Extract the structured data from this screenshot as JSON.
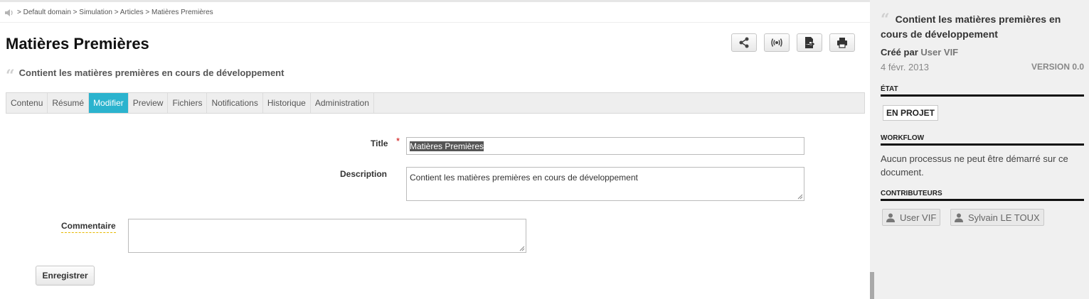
{
  "breadcrumb": "> Default domain > Simulation > Articles > Matières Premières",
  "page": {
    "title": "Matières Premières",
    "subtitle": "Contient les matières premières en cours de développement"
  },
  "actions": [
    {
      "icon": "share-icon"
    },
    {
      "icon": "broadcast-icon"
    },
    {
      "icon": "export-icon"
    },
    {
      "icon": "print-icon"
    }
  ],
  "tabs": [
    {
      "label": "Contenu"
    },
    {
      "label": "Résumé"
    },
    {
      "label": "Modifier",
      "active": true
    },
    {
      "label": "Preview"
    },
    {
      "label": "Fichiers"
    },
    {
      "label": "Notifications"
    },
    {
      "label": "Historique"
    },
    {
      "label": "Administration"
    }
  ],
  "form": {
    "title_label": "Title",
    "required_mark": "*",
    "title_value": "Matières Premières",
    "description_label": "Description",
    "description_value": "Contient les matières premières en cours de développement",
    "comment_label": "Commentaire",
    "comment_value": "",
    "save_label": "Enregistrer"
  },
  "sidebar": {
    "title": "Contient les matières premières en cours de développement",
    "created_prefix": "Créé par",
    "created_by": "User VIF",
    "date": "4 févr. 2013",
    "version": "VERSION 0.0",
    "state_heading": "ÉTAT",
    "state": "EN PROJET",
    "workflow_heading": "WORKFLOW",
    "workflow_text": "Aucun processus ne peut être démarré sur ce document.",
    "contributors_heading": "CONTRIBUTEURS",
    "contributors": [
      "User VIF",
      "Sylvain LE TOUX"
    ]
  },
  "colors": {
    "active_tab": "#2bb3ce",
    "required": "#cc0000",
    "comment_underline": "#e6b800"
  }
}
